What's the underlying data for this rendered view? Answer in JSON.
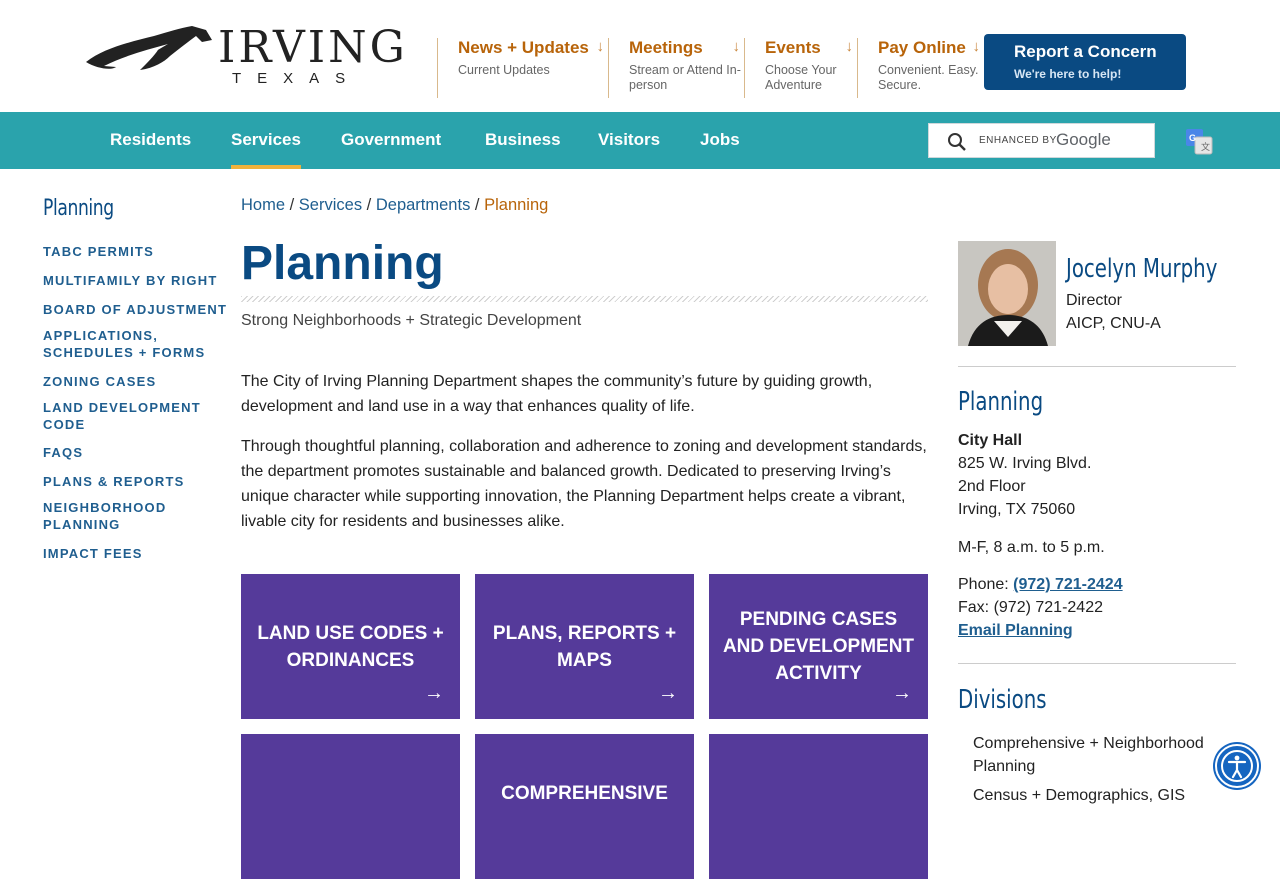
{
  "logo": {
    "word": "IRVING",
    "sub": "TEXAS"
  },
  "quick_links": [
    {
      "title": "News + Updates",
      "sub": "Current Updates"
    },
    {
      "title": "Meetings",
      "sub": "Stream or Attend In-person"
    },
    {
      "title": "Events",
      "sub": "Choose Your Adventure"
    },
    {
      "title": "Pay Online",
      "sub": "Convenient. Easy. Secure."
    }
  ],
  "report": {
    "title": "Report a Concern",
    "sub": "We're here to help!"
  },
  "nav": {
    "items": [
      "Residents",
      "Services",
      "Government",
      "Business",
      "Visitors",
      "Jobs"
    ],
    "active": "Services"
  },
  "search": {
    "label": "ENHANCED BY",
    "brand": "Google"
  },
  "sidebar": {
    "title": "Planning",
    "items": [
      "TABC PERMITS",
      "MULTIFAMILY BY RIGHT",
      "BOARD OF ADJUSTMENT",
      "APPLICATIONS, SCHEDULES + FORMS",
      "ZONING CASES",
      "LAND DEVELOPMENT CODE",
      "FAQS",
      "PLANS & REPORTS",
      "NEIGHBORHOOD PLANNING",
      "IMPACT FEES"
    ]
  },
  "breadcrumb": {
    "home": "Home",
    "services": "Services",
    "departments": "Departments",
    "current": "Planning",
    "sep": "/"
  },
  "main": {
    "title": "Planning",
    "tagline": "Strong Neighborhoods + Strategic Development",
    "para1": "The City of Irving Planning Department shapes the community’s future by guiding growth, development and land use in a way that enhances quality of life.",
    "para2": "Through thoughtful planning, collaboration and adherence to zoning and development standards, the department promotes sustainable and balanced growth. Dedicated to preserving Irving’s unique character while supporting innovation, the Planning Department helps create a vibrant, livable city for residents and businesses alike."
  },
  "tiles": [
    "LAND USE CODES + ORDINANCES",
    "PLANS, REPORTS + MAPS",
    "PENDING CASES AND DEVELOPMENT ACTIVITY",
    "",
    "COMPREHENSIVE",
    ""
  ],
  "tile_arrow": "→",
  "director": {
    "name": "Jocelyn Murphy",
    "role": "Director",
    "credentials": "AICP, CNU-A"
  },
  "contact": {
    "title": "Planning",
    "building": "City Hall",
    "address1": "825 W. Irving Blvd.",
    "address2": "2nd Floor",
    "city": "Irving, TX 75060",
    "hours": "M-F, 8 a.m. to 5 p.m.",
    "phone_label": "Phone:",
    "phone": "(972) 721-2424",
    "fax_label": "Fax:",
    "fax": "(972) 721-2422",
    "email": "Email Planning"
  },
  "divisions": {
    "title": "Divisions",
    "items": [
      "Comprehensive + Neighborhood Planning",
      "Census + Demographics, GIS"
    ]
  },
  "colors": {
    "primary": "#0a4a82",
    "teal": "#2aa3ac",
    "accent": "#b8640a",
    "tile": "#553a9a",
    "gold": "#f0b23b"
  }
}
